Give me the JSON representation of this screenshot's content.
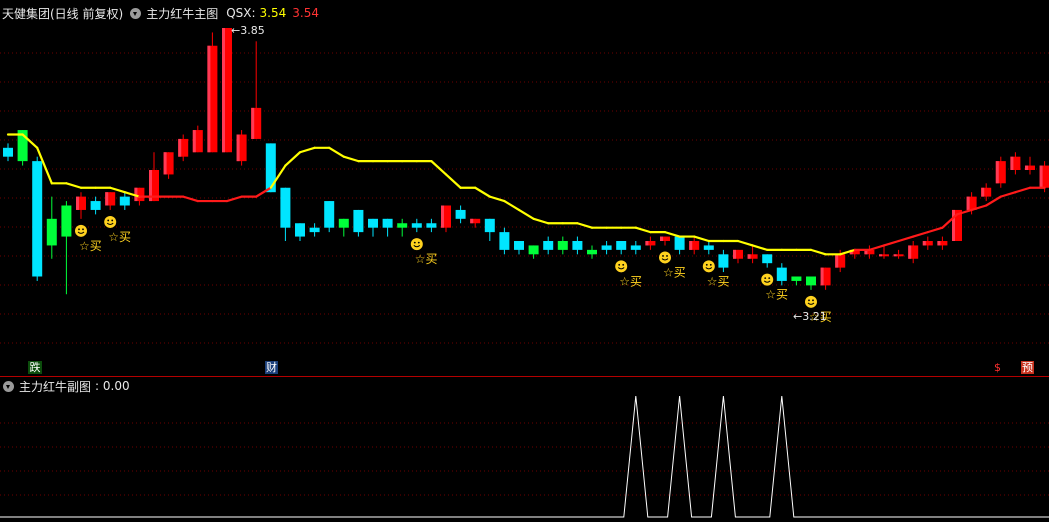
{
  "header": {
    "stock": "天健集团(日线 前复权)",
    "indicator": "主力红牛主图",
    "qsx_label": "QSX:",
    "qsx_value": "3.54",
    "qsx_value2": "3.54"
  },
  "annotations": {
    "high_marker": "3.85",
    "low_marker": "3.21",
    "buy_label": "☆买"
  },
  "event_markers": {
    "die": "跌",
    "cai": "财",
    "dollar": "$",
    "yu": "预"
  },
  "sub_panel": {
    "title": "主力红牛副图",
    "value_label": ": 0.00"
  },
  "colors": {
    "up": "#ff0000",
    "up_highlight": "#ff3a55",
    "down": "#00e5ff",
    "down_green": "#00ff3a",
    "trend_yellow": "#ffff00",
    "trend_red": "#ff1a1a",
    "grid": "#6e0000",
    "smile": "#ffd21f"
  },
  "chart_data": {
    "type": "candlestick",
    "price_range": [
      3.21,
      3.85
    ],
    "candles": [
      {
        "o": 3.58,
        "c": 3.56,
        "h": 3.59,
        "l": 3.55,
        "col": "cyan"
      },
      {
        "o": 3.62,
        "c": 3.55,
        "h": 3.62,
        "l": 3.54,
        "col": "green"
      },
      {
        "o": 3.55,
        "c": 3.29,
        "h": 3.56,
        "l": 3.28,
        "col": "cyan"
      },
      {
        "o": 3.42,
        "c": 3.36,
        "h": 3.47,
        "l": 3.33,
        "col": "green"
      },
      {
        "o": 3.45,
        "c": 3.38,
        "h": 3.46,
        "l": 3.25,
        "col": "green"
      },
      {
        "o": 3.44,
        "c": 3.47,
        "h": 3.48,
        "l": 3.42,
        "col": "red"
      },
      {
        "o": 3.46,
        "c": 3.44,
        "h": 3.47,
        "l": 3.43,
        "col": "cyan"
      },
      {
        "o": 3.45,
        "c": 3.48,
        "h": 3.48,
        "l": 3.44,
        "col": "red"
      },
      {
        "o": 3.47,
        "c": 3.45,
        "h": 3.48,
        "l": 3.44,
        "col": "cyan"
      },
      {
        "o": 3.46,
        "c": 3.49,
        "h": 3.49,
        "l": 3.45,
        "col": "red"
      },
      {
        "o": 3.46,
        "c": 3.53,
        "h": 3.57,
        "l": 3.46,
        "col": "red"
      },
      {
        "o": 3.52,
        "c": 3.57,
        "h": 3.57,
        "l": 3.51,
        "col": "red"
      },
      {
        "o": 3.56,
        "c": 3.6,
        "h": 3.61,
        "l": 3.55,
        "col": "red"
      },
      {
        "o": 3.57,
        "c": 3.62,
        "h": 3.63,
        "l": 3.57,
        "col": "red"
      },
      {
        "o": 3.57,
        "c": 3.81,
        "h": 3.84,
        "l": 3.57,
        "col": "red"
      },
      {
        "o": 3.57,
        "c": 3.85,
        "h": 3.85,
        "l": 3.57,
        "col": "red"
      },
      {
        "o": 3.61,
        "c": 3.55,
        "h": 3.62,
        "l": 3.54,
        "col": "red"
      },
      {
        "o": 3.67,
        "c": 3.6,
        "h": 3.82,
        "l": 3.6,
        "col": "red"
      },
      {
        "o": 3.59,
        "c": 3.48,
        "h": 3.59,
        "l": 3.48,
        "col": "cyan"
      },
      {
        "o": 3.49,
        "c": 3.4,
        "h": 3.49,
        "l": 3.37,
        "col": "cyan"
      },
      {
        "o": 3.41,
        "c": 3.38,
        "h": 3.41,
        "l": 3.37,
        "col": "cyan"
      },
      {
        "o": 3.4,
        "c": 3.39,
        "h": 3.41,
        "l": 3.38,
        "col": "cyan"
      },
      {
        "o": 3.46,
        "c": 3.4,
        "h": 3.46,
        "l": 3.39,
        "col": "cyan"
      },
      {
        "o": 3.42,
        "c": 3.4,
        "h": 3.42,
        "l": 3.38,
        "col": "green"
      },
      {
        "o": 3.44,
        "c": 3.39,
        "h": 3.44,
        "l": 3.38,
        "col": "cyan"
      },
      {
        "o": 3.42,
        "c": 3.4,
        "h": 3.42,
        "l": 3.38,
        "col": "cyan"
      },
      {
        "o": 3.42,
        "c": 3.4,
        "h": 3.42,
        "l": 3.38,
        "col": "cyan"
      },
      {
        "o": 3.41,
        "c": 3.4,
        "h": 3.42,
        "l": 3.38,
        "col": "green"
      },
      {
        "o": 3.41,
        "c": 3.4,
        "h": 3.42,
        "l": 3.39,
        "col": "cyan"
      },
      {
        "o": 3.41,
        "c": 3.4,
        "h": 3.42,
        "l": 3.39,
        "col": "cyan"
      },
      {
        "o": 3.4,
        "c": 3.45,
        "h": 3.45,
        "l": 3.39,
        "col": "red"
      },
      {
        "o": 3.44,
        "c": 3.42,
        "h": 3.45,
        "l": 3.41,
        "col": "cyan"
      },
      {
        "o": 3.41,
        "c": 3.42,
        "h": 3.42,
        "l": 3.4,
        "col": "red"
      },
      {
        "o": 3.42,
        "c": 3.39,
        "h": 3.42,
        "l": 3.37,
        "col": "cyan"
      },
      {
        "o": 3.39,
        "c": 3.35,
        "h": 3.4,
        "l": 3.34,
        "col": "cyan"
      },
      {
        "o": 3.37,
        "c": 3.35,
        "h": 3.37,
        "l": 3.34,
        "col": "cyan"
      },
      {
        "o": 3.36,
        "c": 3.34,
        "h": 3.36,
        "l": 3.33,
        "col": "green"
      },
      {
        "o": 3.37,
        "c": 3.35,
        "h": 3.38,
        "l": 3.34,
        "col": "cyan"
      },
      {
        "o": 3.37,
        "c": 3.35,
        "h": 3.38,
        "l": 3.34,
        "col": "green"
      },
      {
        "o": 3.37,
        "c": 3.35,
        "h": 3.38,
        "l": 3.34,
        "col": "cyan"
      },
      {
        "o": 3.35,
        "c": 3.34,
        "h": 3.36,
        "l": 3.33,
        "col": "green"
      },
      {
        "o": 3.36,
        "c": 3.35,
        "h": 3.37,
        "l": 3.34,
        "col": "cyan"
      },
      {
        "o": 3.37,
        "c": 3.35,
        "h": 3.37,
        "l": 3.34,
        "col": "cyan"
      },
      {
        "o": 3.36,
        "c": 3.35,
        "h": 3.37,
        "l": 3.34,
        "col": "cyan"
      },
      {
        "o": 3.36,
        "c": 3.37,
        "h": 3.38,
        "l": 3.35,
        "col": "red"
      },
      {
        "o": 3.37,
        "c": 3.38,
        "h": 3.38,
        "l": 3.36,
        "col": "red"
      },
      {
        "o": 3.38,
        "c": 3.35,
        "h": 3.38,
        "l": 3.34,
        "col": "cyan"
      },
      {
        "o": 3.35,
        "c": 3.37,
        "h": 3.38,
        "l": 3.34,
        "col": "red"
      },
      {
        "o": 3.36,
        "c": 3.35,
        "h": 3.37,
        "l": 3.34,
        "col": "cyan"
      },
      {
        "o": 3.34,
        "c": 3.31,
        "h": 3.35,
        "l": 3.3,
        "col": "cyan"
      },
      {
        "o": 3.33,
        "c": 3.35,
        "h": 3.35,
        "l": 3.32,
        "col": "red"
      },
      {
        "o": 3.34,
        "c": 3.33,
        "h": 3.36,
        "l": 3.32,
        "col": "red"
      },
      {
        "o": 3.34,
        "c": 3.32,
        "h": 3.34,
        "l": 3.31,
        "col": "cyan"
      },
      {
        "o": 3.31,
        "c": 3.28,
        "h": 3.32,
        "l": 3.27,
        "col": "cyan"
      },
      {
        "o": 3.29,
        "c": 3.28,
        "h": 3.29,
        "l": 3.27,
        "col": "green"
      },
      {
        "o": 3.29,
        "c": 3.27,
        "h": 3.29,
        "l": 3.26,
        "col": "green"
      },
      {
        "o": 3.27,
        "c": 3.31,
        "h": 3.31,
        "l": 3.26,
        "col": "red"
      },
      {
        "o": 3.31,
        "c": 3.34,
        "h": 3.35,
        "l": 3.3,
        "col": "red"
      },
      {
        "o": 3.34,
        "c": 3.35,
        "h": 3.35,
        "l": 3.33,
        "col": "red"
      },
      {
        "o": 3.34,
        "c": 3.35,
        "h": 3.36,
        "l": 3.33,
        "col": "red"
      },
      {
        "o": 3.34,
        "c": 3.34,
        "h": 3.36,
        "l": 3.33,
        "col": "red"
      },
      {
        "o": 3.34,
        "c": 3.34,
        "h": 3.35,
        "l": 3.33,
        "col": "red"
      },
      {
        "o": 3.33,
        "c": 3.36,
        "h": 3.37,
        "l": 3.32,
        "col": "red"
      },
      {
        "o": 3.36,
        "c": 3.37,
        "h": 3.38,
        "l": 3.35,
        "col": "red"
      },
      {
        "o": 3.36,
        "c": 3.37,
        "h": 3.38,
        "l": 3.35,
        "col": "red"
      },
      {
        "o": 3.37,
        "c": 3.44,
        "h": 3.44,
        "l": 3.37,
        "col": "red"
      },
      {
        "o": 3.44,
        "c": 3.47,
        "h": 3.48,
        "l": 3.43,
        "col": "red"
      },
      {
        "o": 3.47,
        "c": 3.49,
        "h": 3.5,
        "l": 3.46,
        "col": "red"
      },
      {
        "o": 3.5,
        "c": 3.55,
        "h": 3.56,
        "l": 3.49,
        "col": "red"
      },
      {
        "o": 3.53,
        "c": 3.56,
        "h": 3.57,
        "l": 3.52,
        "col": "red"
      },
      {
        "o": 3.54,
        "c": 3.53,
        "h": 3.56,
        "l": 3.52,
        "col": "red"
      },
      {
        "o": 3.54,
        "c": 3.49,
        "h": 3.55,
        "l": 3.48,
        "col": "red"
      }
    ],
    "trend_line": [
      3.61,
      3.61,
      3.58,
      3.5,
      3.5,
      3.49,
      3.49,
      3.49,
      3.48,
      3.47,
      3.47,
      3.47,
      3.47,
      3.46,
      3.46,
      3.46,
      3.47,
      3.47,
      3.49,
      3.54,
      3.57,
      3.58,
      3.58,
      3.56,
      3.55,
      3.55,
      3.55,
      3.55,
      3.55,
      3.55,
      3.52,
      3.49,
      3.49,
      3.47,
      3.46,
      3.44,
      3.42,
      3.41,
      3.41,
      3.41,
      3.4,
      3.4,
      3.4,
      3.4,
      3.39,
      3.39,
      3.38,
      3.38,
      3.37,
      3.37,
      3.37,
      3.36,
      3.35,
      3.35,
      3.35,
      3.35,
      3.34,
      3.34,
      3.35,
      3.35,
      3.36,
      3.37,
      3.38,
      3.39,
      3.4,
      3.43,
      3.44,
      3.45,
      3.47,
      3.48,
      3.49,
      3.49
    ],
    "trend_red_from_index": [
      9,
      10,
      11,
      12,
      13,
      14,
      15,
      16,
      17,
      18,
      58,
      59,
      60,
      61,
      62,
      63,
      64,
      65,
      66,
      67,
      68,
      69,
      70,
      71
    ],
    "buy_signals": [
      5,
      7,
      28,
      42,
      45,
      48,
      52,
      55
    ],
    "sub_peaks": [
      43,
      46,
      49,
      53
    ],
    "sub_value": 0.0
  }
}
